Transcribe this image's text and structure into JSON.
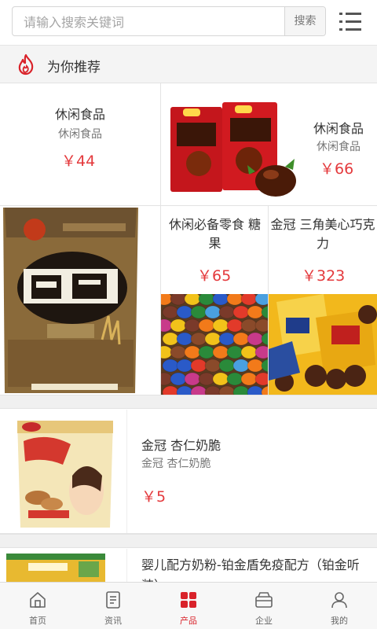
{
  "search": {
    "placeholder": "请输入搜索关键词",
    "button": "搜索"
  },
  "section": {
    "title": "为你推荐"
  },
  "grid": {
    "item1": {
      "name": "休闲食品",
      "sub": "休闲食品",
      "price": "￥44"
    },
    "item2": {
      "name": "休闲食品",
      "sub": "休闲食品",
      "price": "￥66"
    },
    "item3": {
      "name": "休闲必备零食 糖果",
      "price": "￥65"
    },
    "item4": {
      "name": "金冠 三角美心巧克力",
      "price": "￥323"
    }
  },
  "list": [
    {
      "name": "金冠 杏仁奶脆",
      "sub": "金冠 杏仁奶脆",
      "price": "￥5"
    },
    {
      "name": "婴儿配方奶粉-铂金盾免疫配方（铂金听装）"
    }
  ],
  "nav": [
    {
      "label": "首页",
      "icon": "home-icon"
    },
    {
      "label": "资讯",
      "icon": "news-icon"
    },
    {
      "label": "产品",
      "icon": "product-icon"
    },
    {
      "label": "企业",
      "icon": "company-icon"
    },
    {
      "label": "我的",
      "icon": "user-icon"
    }
  ],
  "colors": {
    "accent": "#e4393c",
    "nav_active": "#d9222a"
  }
}
